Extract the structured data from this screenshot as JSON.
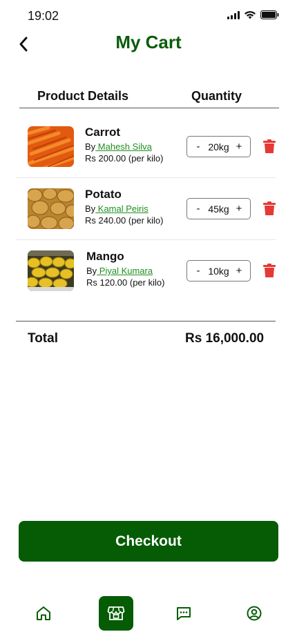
{
  "status_bar": {
    "time": "19:02"
  },
  "header": {
    "title": "My Cart"
  },
  "columns": {
    "product": "Product Details",
    "quantity": "Quantity"
  },
  "items": [
    {
      "name": "Carrot",
      "by": "By",
      "seller": " Mahesh Silva",
      "price": "Rs 200.00 (per kilo)",
      "quantity": "20kg",
      "minus": "-",
      "plus": "+"
    },
    {
      "name": "Potato",
      "by": "By",
      "seller": " Kamal Peiris",
      "price": "Rs 240.00 (per kilo)",
      "quantity": "45kg",
      "minus": "-",
      "plus": "+"
    },
    {
      "name": "Mango",
      "by": "By",
      "seller": " Piyal Kumara",
      "price": "Rs 120.00 (per kilo)",
      "quantity": "10kg",
      "minus": "-",
      "plus": "+"
    }
  ],
  "total": {
    "label": "Total",
    "value": "Rs 16,000.00"
  },
  "checkout": {
    "label": "Checkout"
  },
  "nav": {
    "active": "store",
    "icons": [
      "home-icon",
      "store-icon",
      "chat-icon",
      "profile-icon"
    ]
  },
  "colors": {
    "brand_green": "#055c05",
    "title_green": "#0a5c0a",
    "link_green": "#1f8f1f",
    "delete_red": "#e53935"
  }
}
